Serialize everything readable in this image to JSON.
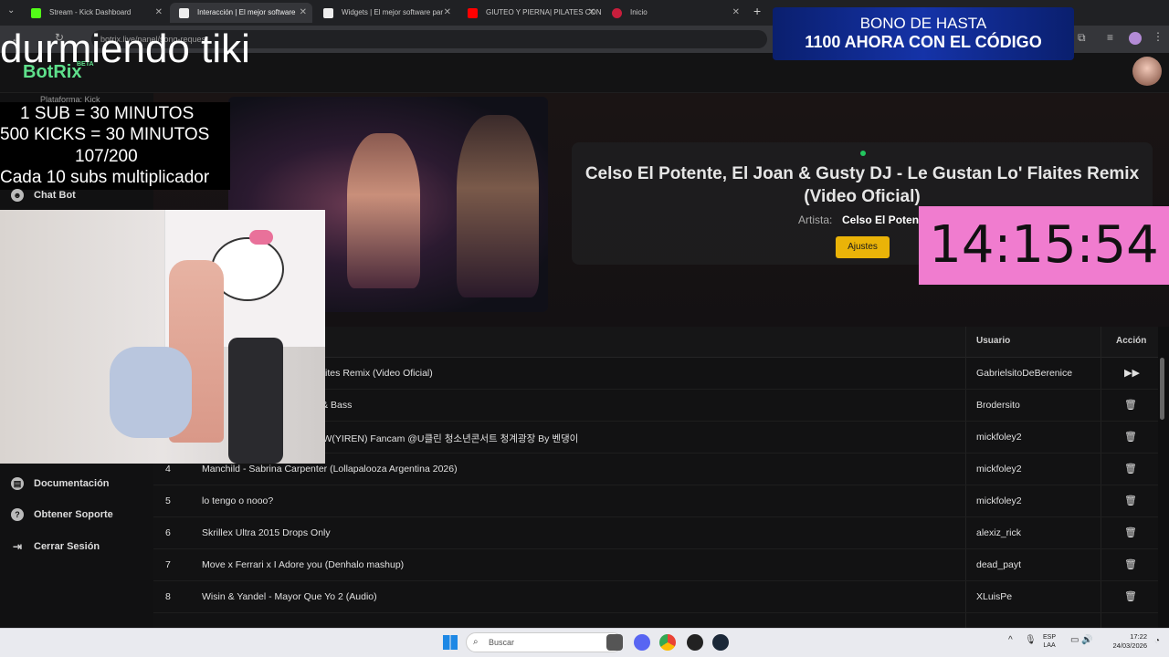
{
  "browser": {
    "tabs": [
      {
        "label": "Stream - Kick Dashboard",
        "active": false
      },
      {
        "label": "Interacción | El mejor software",
        "active": true
      },
      {
        "label": "Widgets | El mejor software par",
        "active": false
      },
      {
        "label": "GIUTEO Y PIERNA| PILATES CON",
        "active": false
      },
      {
        "label": "Inicio",
        "active": false
      }
    ],
    "new_tab_label": "+",
    "url": "botrix.live/panel/song-request"
  },
  "app": {
    "logo": "BotRix",
    "logo_badge": "BETA",
    "platform_label": "Plataforma: Kick",
    "sidebar": {
      "items": [
        {
          "label": "Chat Bot"
        },
        {
          "label": "Documentación"
        },
        {
          "label": "Obtener Soporte"
        },
        {
          "label": "Cerrar Sesión"
        }
      ]
    },
    "now_playing": {
      "title": "Celso El Potente, El Joan & Gusty DJ - Le Gustan Lo' Flaites Remix (Video Oficial)",
      "artist_label": "Artista:",
      "artist_value": "Celso El Potente",
      "settings_button": "Ajustes"
    },
    "queue": {
      "headers": {
        "user": "Usuario",
        "action": "Acción"
      },
      "rows": [
        {
          "num": "",
          "title": "Gusty DJ - Le Gustan Lo' Flaites Remix (Video Oficial)",
          "user": "GabrielsitoDeBerenice",
          "action": "▶▶"
        },
        {
          "num": "",
          "title": "o & Krooked Remix) | Drum & Bass",
          "user": "Brodersito",
          "action": "🗑"
        },
        {
          "num": "",
          "title": "직캠 '달아(Moon)' EVERGLOW(YIREN) Fancam @U클린 청소년콘서트 청계광장 By 벤댕이",
          "user": "mickfoley2",
          "action": "🗑"
        },
        {
          "num": "4",
          "title": "Manchild - Sabrina Carpenter (Lollapalooza Argentina 2026)",
          "user": "mickfoley2",
          "action": "🗑"
        },
        {
          "num": "5",
          "title": "lo tengo o nooo?",
          "user": "mickfoley2",
          "action": "🗑"
        },
        {
          "num": "6",
          "title": "Skrillex Ultra 2015 Drops Only",
          "user": "alexiz_rick",
          "action": "🗑"
        },
        {
          "num": "7",
          "title": "Move x Ferrari x I Adore you (Denhalo mashup)",
          "user": "dead_payt",
          "action": "🗑"
        },
        {
          "num": "8",
          "title": "Wisin & Yandel - Mayor Que Yo 2 (Audio)",
          "user": "XLuisPe",
          "action": "🗑"
        }
      ]
    }
  },
  "overlay": {
    "title": "durmiendo tiki",
    "rules": [
      "1 SUB      = 30 MINUTOS",
      "500 KICKS = 30 MINUTOS",
      "107/200",
      "Cada 10 subs multiplicador"
    ],
    "promo_line1": "BONO DE HASTA",
    "promo_line2": "1100 AHORA CON EL CÓDIGO",
    "timer": "14:15:54"
  },
  "taskbar": {
    "search_placeholder": "Buscar",
    "lang": "ESP\nLAA",
    "time": "17:22",
    "date": "24/03/2026"
  },
  "colors": {
    "accent_green": "#22c55e",
    "button_yellow": "#eab308",
    "timer_pink": "#f07ccf",
    "promo_blue": "#1533a8"
  }
}
